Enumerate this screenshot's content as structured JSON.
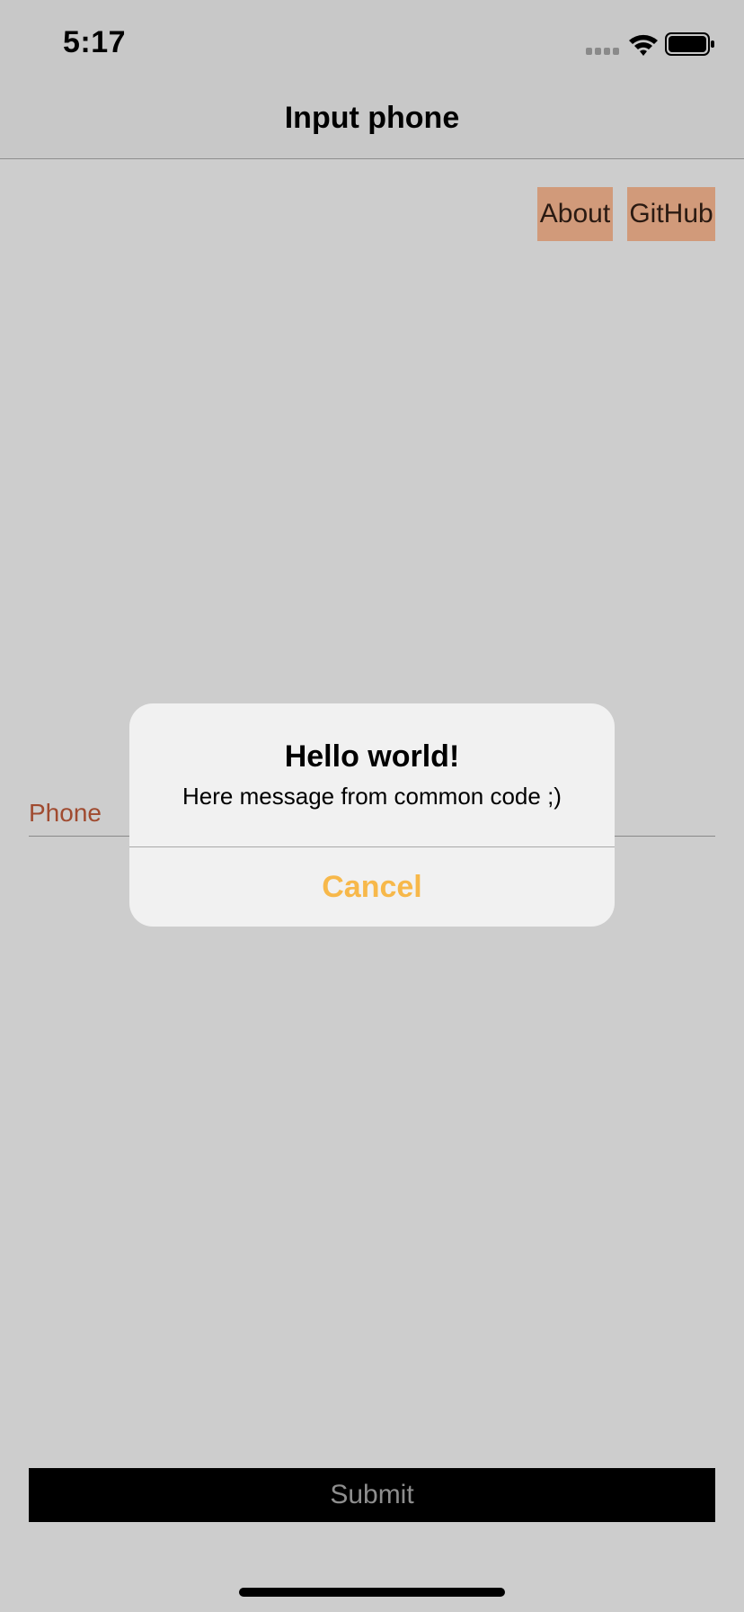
{
  "status_bar": {
    "time": "5:17",
    "icons": [
      "cellular-signal-icon",
      "wifi-icon",
      "battery-icon"
    ]
  },
  "nav": {
    "title": "Input phone"
  },
  "menu": {
    "about_label": "About",
    "github_label": "GitHub"
  },
  "form": {
    "phone_placeholder": "Phone",
    "submit_label": "Submit"
  },
  "alert": {
    "title": "Hello world!",
    "message": "Here message from common code ;)",
    "cancel_label": "Cancel"
  },
  "colors": {
    "background": "#cdcdcd",
    "menu_button": "#d19a7a",
    "phone_label": "#a04b30",
    "alert_action": "#f7b84a",
    "submit_background": "#000000"
  }
}
